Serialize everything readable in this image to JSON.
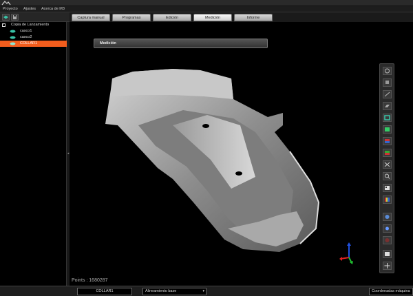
{
  "menu": {
    "items": [
      "Proyecto",
      "Ajustes",
      "Acerca de M3"
    ]
  },
  "tabs": [
    {
      "label": "Captura manual",
      "active": false
    },
    {
      "label": "Programas",
      "active": false
    },
    {
      "label": "Edición",
      "active": false
    },
    {
      "label": "Medición",
      "active": true
    },
    {
      "label": "Informe",
      "active": false
    }
  ],
  "tree": {
    "root": "Copia de Lanzamiento",
    "items": [
      {
        "label": "casco1",
        "selected": false
      },
      {
        "label": "casco2",
        "selected": false
      },
      {
        "label": "COLLAR1",
        "selected": true
      }
    ]
  },
  "panel": {
    "title": "Medición"
  },
  "viewport": {
    "points_label": "Points : 1680287"
  },
  "right_toolbar": {
    "icons": [
      "select-icon",
      "cube-icon",
      "line-icon",
      "plane-icon",
      "box-icon",
      "grid-icon",
      "layers-icon",
      "section-icon",
      "fit-icon",
      "zoom-icon",
      "display-icon",
      "color-map-icon",
      "camera-icon",
      "lighting-icon",
      "render-icon",
      "shading-icon",
      "reset-icon"
    ]
  },
  "status": {
    "object": "COLLAR1",
    "alignment": "Alineamiento base",
    "coords": "Coordenadas máquina"
  },
  "colors": {
    "selection": "#f25d1d",
    "tree_icon": "#39c4a8",
    "axis_x": "#e02020",
    "axis_y": "#20c030",
    "axis_z": "#2050e0"
  }
}
